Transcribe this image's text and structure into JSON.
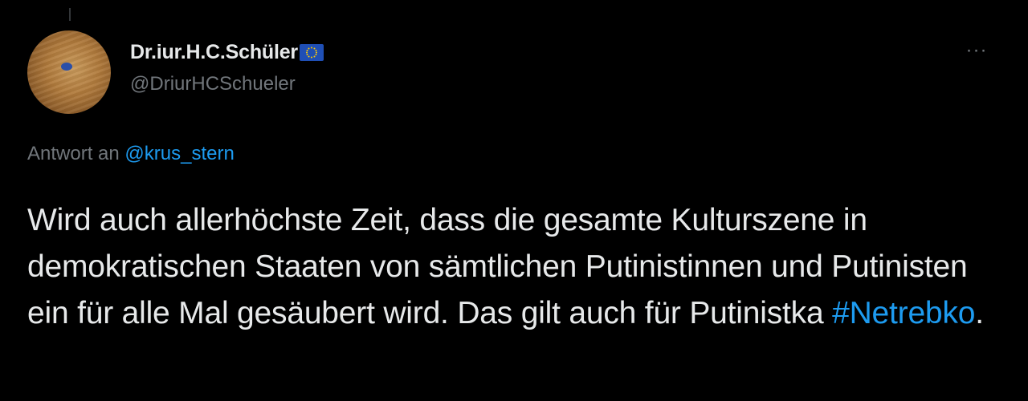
{
  "tweet": {
    "author": {
      "display_name": "Dr.iur.H.C.Schüler",
      "handle": "@DriurHCSchueler"
    },
    "reply": {
      "prefix": "Antwort an ",
      "mention": "@krus_stern"
    },
    "text_before_hashtag": "Wird auch allerhöchste Zeit, dass die gesamte Kulturszene in demokratischen Staaten von sämtlichen Putinistinnen und Putinisten ein für alle Mal gesäubert wird. Das gilt auch für Putinistka ",
    "hashtag": "#Netrebko",
    "text_after_hashtag": ".",
    "more_label": "···"
  },
  "icons": {
    "avatar": "avatar-image",
    "flag": "eu-flag-icon",
    "more": "more-options-icon"
  },
  "colors": {
    "background": "#000000",
    "primary_text": "#e7e9ea",
    "secondary_text": "#71767b",
    "link": "#1d9bf0",
    "flag_blue": "#1f4fb5",
    "flag_star": "#ffcc00"
  }
}
